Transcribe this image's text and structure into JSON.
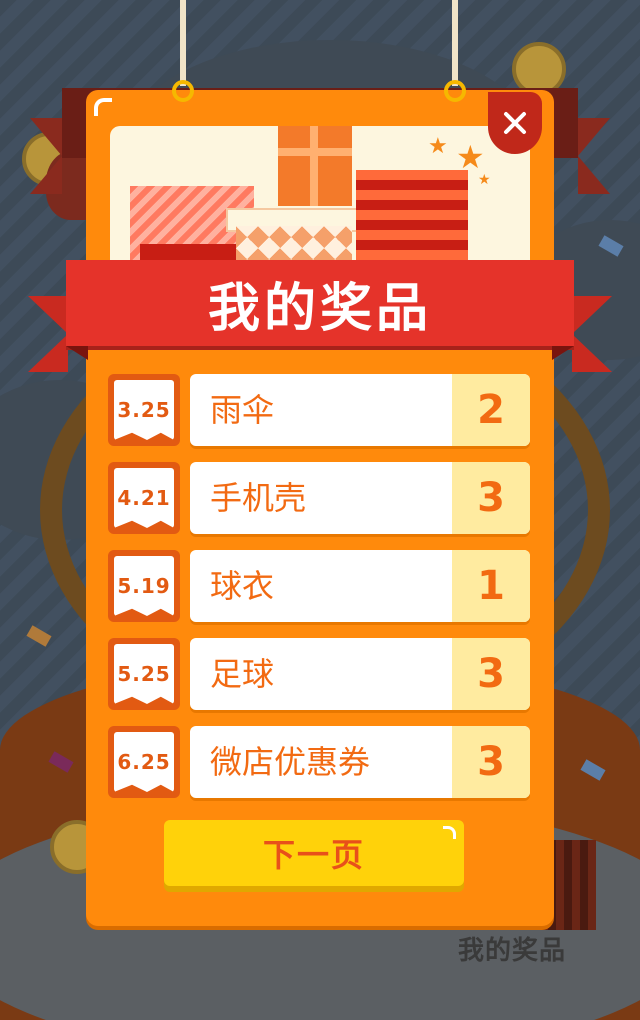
{
  "dialog": {
    "title": "我的奖品",
    "close_icon": "close-icon",
    "next_page_label": "下一页"
  },
  "prizes": [
    {
      "date": "3.25",
      "name": "雨伞",
      "count": "2"
    },
    {
      "date": "4.21",
      "name": "手机壳",
      "count": "3"
    },
    {
      "date": "5.19",
      "name": "球衣",
      "count": "1"
    },
    {
      "date": "5.25",
      "name": "足球",
      "count": "3"
    },
    {
      "date": "6.25",
      "name": "微店优惠券",
      "count": "3"
    }
  ],
  "background": {
    "caption": "我的奖品"
  },
  "colors": {
    "card": "#ff8a0c",
    "ribbon": "#e5332a",
    "count_bg": "#ffeba0",
    "button": "#ffd20a",
    "text_accent": "#f26a12"
  }
}
